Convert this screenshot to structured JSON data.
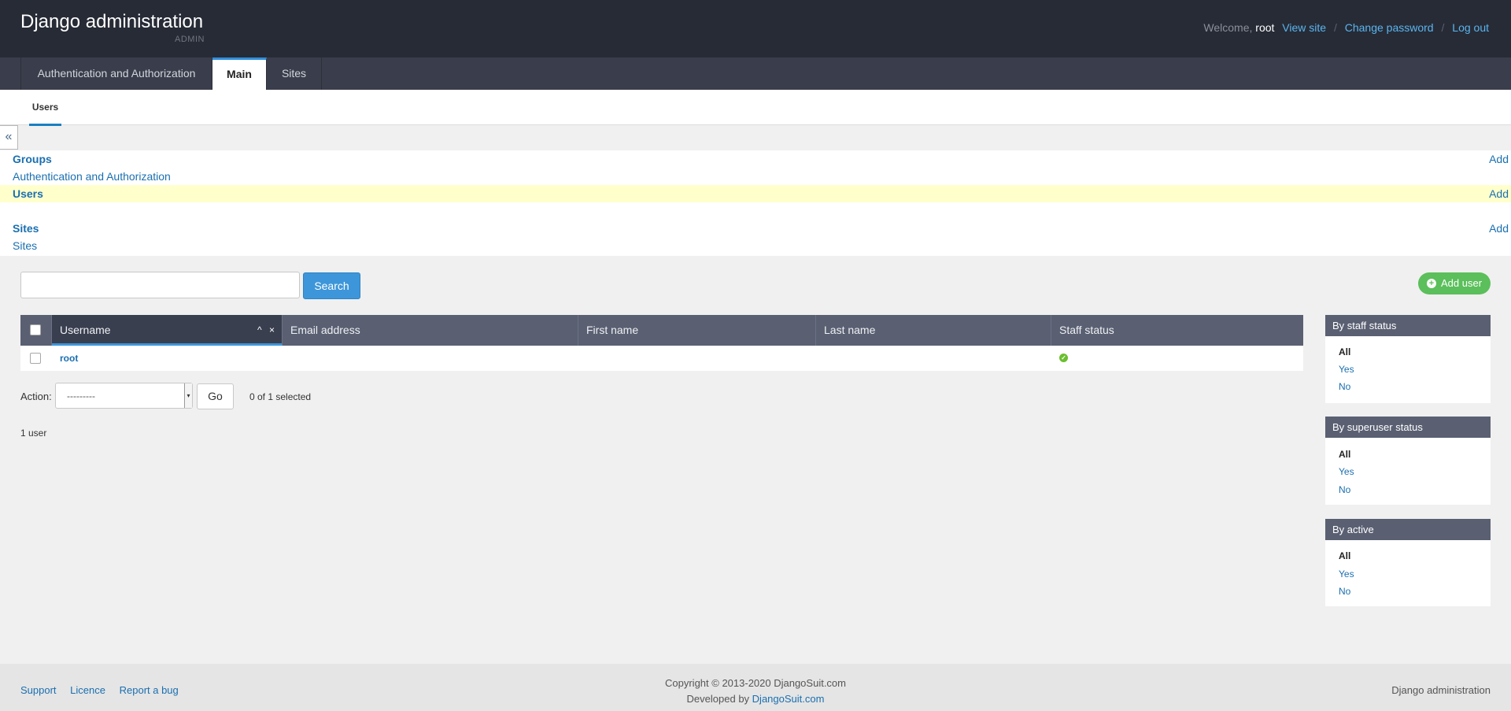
{
  "header": {
    "title": "Django administration",
    "subtitle": "ADMIN",
    "welcome": "Welcome,",
    "username": "root",
    "links": [
      "View site",
      "Change password",
      "Log out"
    ]
  },
  "tabs": [
    "Authentication and Authorization",
    "Main",
    "Sites"
  ],
  "active_tab": "Main",
  "subtabs": [
    "Users"
  ],
  "collapse_glyph": "«",
  "applist": [
    {
      "model": "Groups",
      "app": "Authentication and Authorization",
      "add": "Add",
      "highlighted": false
    },
    {
      "model": "Users",
      "app": "",
      "add": "Add",
      "highlighted": true
    },
    {
      "model": "Sites",
      "app": "Sites",
      "add": "Add",
      "highlighted": false
    }
  ],
  "search": {
    "button": "Search",
    "value": ""
  },
  "add_user": "Add user",
  "table": {
    "columns": [
      "Username",
      "Email address",
      "First name",
      "Last name",
      "Staff status"
    ],
    "sort_icons": "^ ×",
    "rows": [
      {
        "username": "root",
        "email": "",
        "first_name": "",
        "last_name": "",
        "staff_status": true
      }
    ]
  },
  "actions": {
    "label": "Action:",
    "selected_option": "---------",
    "go": "Go",
    "selection": "0 of 1 selected"
  },
  "paginator": "1 user",
  "filters": [
    {
      "title": "By staff status",
      "options": [
        "All",
        "Yes",
        "No"
      ],
      "selected": "All"
    },
    {
      "title": "By superuser status",
      "options": [
        "All",
        "Yes",
        "No"
      ],
      "selected": "All"
    },
    {
      "title": "By active",
      "options": [
        "All",
        "Yes",
        "No"
      ],
      "selected": "All"
    }
  ],
  "footer": {
    "links": [
      "Support",
      "Licence",
      "Report a bug"
    ],
    "copyright": "Copyright © 2013-2020 DjangoSuit.com",
    "developed_by": "Developed by",
    "developer": "DjangoSuit.com",
    "right": "Django administration"
  },
  "colors": {
    "accent": "#3d96d9",
    "header_bg": "#272b36",
    "success": "#5bbf5b",
    "highlight": "#ffffcc"
  }
}
